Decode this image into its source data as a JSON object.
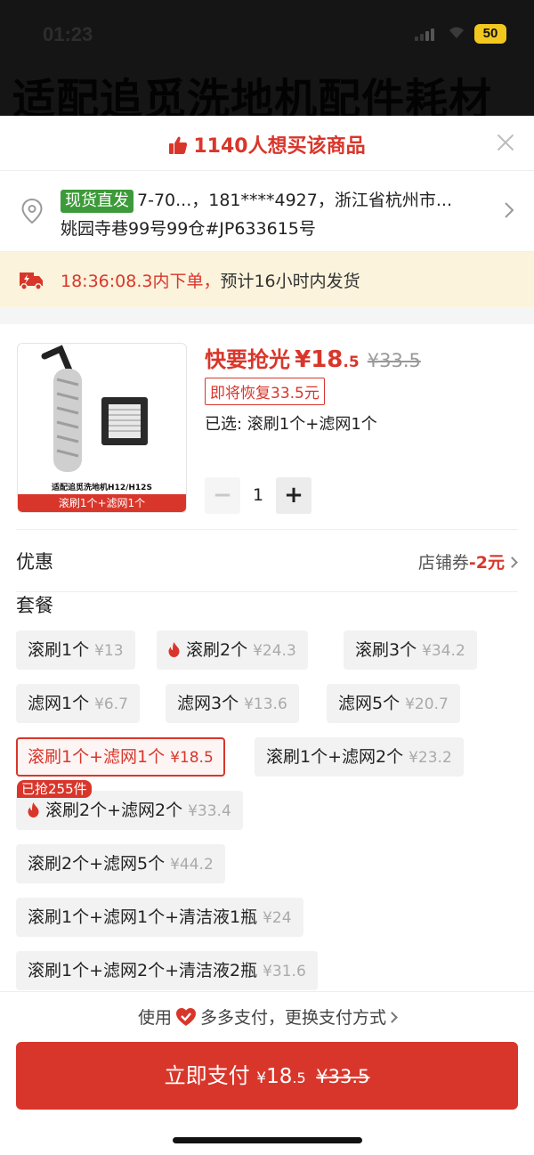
{
  "status_bar": {
    "time": "01:23",
    "battery": "50"
  },
  "background_title": "适配追觅洗地机配件耗材",
  "header": {
    "title": "1140人想买该商品"
  },
  "address": {
    "tag": "现货直发",
    "line1": "7-70...，181****4927，浙江省杭州市...",
    "line2": "姚园寺巷99号99仓#JP633615号"
  },
  "shipping": {
    "time": "18:36:08.3内下单，",
    "text": "预计16小时内发货"
  },
  "product": {
    "hurry": "快要抢光",
    "currency": "¥",
    "price_int": "18",
    "price_dec": ".5",
    "old_price": "¥33.5",
    "restore_tag": "即将恢复33.5元",
    "selected": "已选: 滚刷1个+滤网1个",
    "image_caption": "适配追觅洗地机H12/H12S",
    "image_band": "滚刷1个+滤网1个",
    "quantity": "1",
    "minus": "−",
    "plus": "+"
  },
  "coupon": {
    "label": "优惠",
    "value_prefix": "店铺券",
    "value": "-2元"
  },
  "package": {
    "label": "套餐",
    "sold_badge": "已抢255件",
    "options": [
      {
        "label": "滚刷1个",
        "price": "¥13"
      },
      {
        "label": "滚刷2个",
        "price": "¥24.3",
        "hot": true
      },
      {
        "label": "滚刷3个",
        "price": "¥34.2"
      },
      {
        "label": "滤网1个",
        "price": "¥6.7"
      },
      {
        "label": "滤网3个",
        "price": "¥13.6"
      },
      {
        "label": "滤网5个",
        "price": "¥20.7"
      },
      {
        "label": "滚刷1个+滤网1个",
        "price": "¥18.5",
        "selected": true
      },
      {
        "label": "滚刷1个+滤网2个",
        "price": "¥23.2"
      },
      {
        "label": "滚刷2个+滤网2个",
        "price": "¥33.4",
        "hot": true
      },
      {
        "label": "滚刷2个+滤网5个",
        "price": "¥44.2"
      },
      {
        "label": "滚刷1个+滤网1个+清洁液1瓶",
        "price": "¥24"
      },
      {
        "label": "滚刷1个+滤网2个+清洁液2瓶",
        "price": "¥31.6"
      }
    ]
  },
  "footer": {
    "pay_prefix": "使用",
    "pay_method": "多多支付，更换支付方式",
    "pay_button": "立即支付",
    "pay_currency": "¥",
    "pay_int": "18",
    "pay_dec": ".5",
    "pay_old": "¥33.5"
  },
  "colors": {
    "accent": "#d9362b",
    "green_tag": "#3d9a3a",
    "ship_bg": "#fbf3dc"
  }
}
